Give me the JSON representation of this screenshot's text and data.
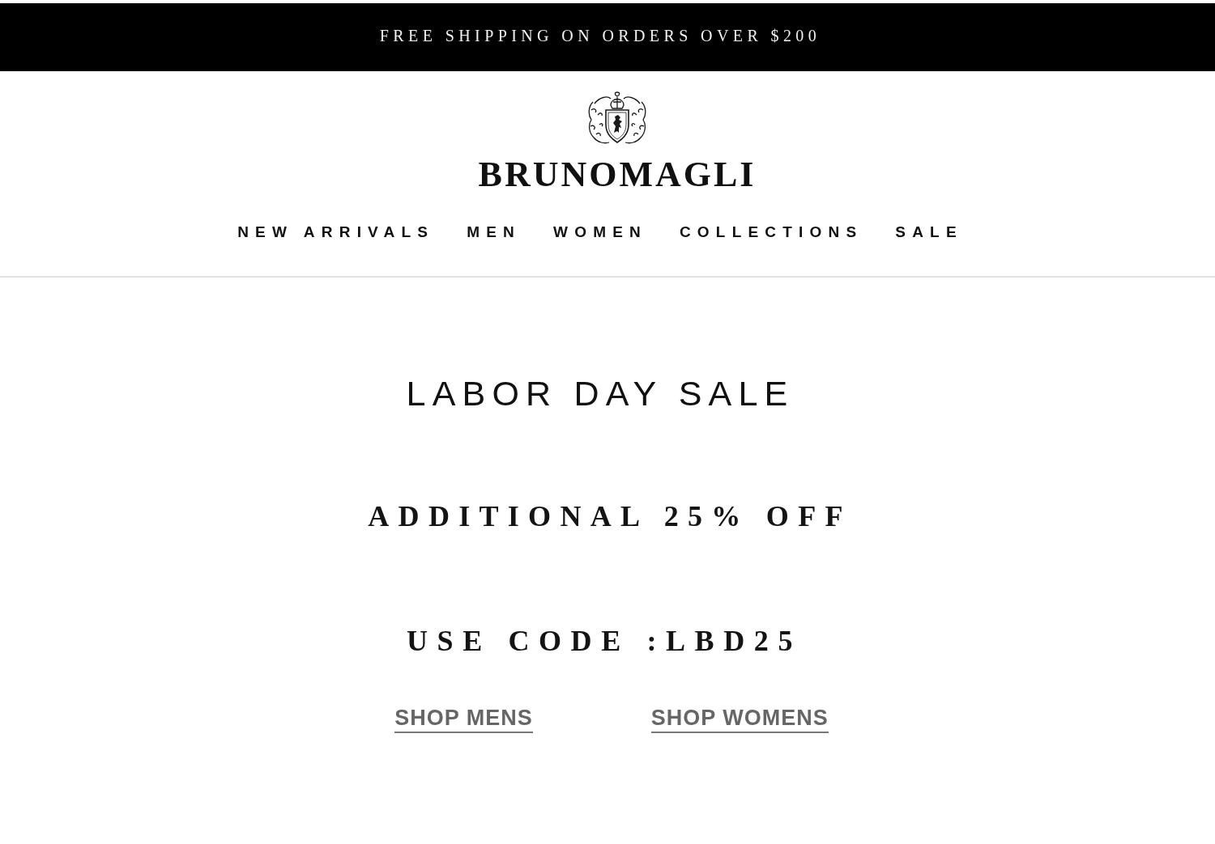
{
  "announcement_bar": {
    "text": "FREE SHIPPING ON ORDERS OVER $200"
  },
  "header": {
    "brand": "BRUNOMAGLI",
    "nav": [
      {
        "label": "NEW ARRIVALS"
      },
      {
        "label": "MEN"
      },
      {
        "label": "WOMEN"
      },
      {
        "label": "COLLECTIONS"
      },
      {
        "label": "SALE"
      }
    ]
  },
  "promo": {
    "title": "LABOR DAY SALE",
    "offer": "ADDITIONAL 25% OFF",
    "code_line": "USE CODE :LBD25",
    "links": [
      {
        "label": "SHOP MENS"
      },
      {
        "label": "SHOP WOMENS"
      }
    ]
  }
}
